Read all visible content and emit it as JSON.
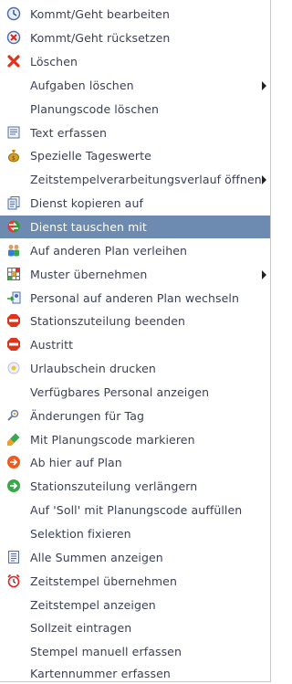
{
  "menu": {
    "items": [
      {
        "label": "Kommt/Geht bearbeiten",
        "icon": "clock-edit-icon"
      },
      {
        "label": "Kommt/Geht rücksetzen",
        "icon": "clock-reset-icon"
      },
      {
        "label": "Löschen",
        "icon": "delete-x-icon"
      },
      {
        "label": "Aufgaben löschen",
        "icon": "",
        "submenu": true
      },
      {
        "label": "Planungscode löschen",
        "icon": ""
      },
      {
        "label": "Text erfassen",
        "icon": "text-note-icon"
      },
      {
        "label": "Spezielle Tageswerte",
        "icon": "money-bag-icon"
      },
      {
        "label": "Zeitstempelverarbeitungsverlauf öffnen",
        "icon": "",
        "submenu": true
      },
      {
        "label": "Dienst kopieren auf",
        "icon": "copy-icon"
      },
      {
        "label": "Dienst tauschen mit",
        "icon": "swap-icon",
        "highlighted": true
      },
      {
        "label": "Auf anderen Plan verleihen",
        "icon": "lend-people-icon"
      },
      {
        "label": "Muster übernehmen",
        "icon": "pattern-grid-icon",
        "submenu": true
      },
      {
        "label": "Personal auf anderen Plan wechseln",
        "icon": "transfer-person-icon"
      },
      {
        "label": "Stationszuteilung beenden",
        "icon": "stop-sign-icon"
      },
      {
        "label": "Austritt",
        "icon": "stop-sign-icon"
      },
      {
        "label": "Urlaubschein drucken",
        "icon": "sun-icon"
      },
      {
        "label": "Verfügbares Personal anzeigen",
        "icon": ""
      },
      {
        "label": "Änderungen für Tag",
        "icon": "person-search-icon"
      },
      {
        "label": "Mit Planungscode markieren",
        "icon": "marker-brush-icon"
      },
      {
        "label": "Ab hier auf Plan",
        "icon": "orange-arrow-right-icon"
      },
      {
        "label": "Stationszuteilung verlängern",
        "icon": "green-arrow-right-icon"
      },
      {
        "label": "Auf 'Soll' mit Planungscode auffüllen",
        "icon": ""
      },
      {
        "label": "Selektion fixieren",
        "icon": ""
      },
      {
        "label": "Alle Summen anzeigen",
        "icon": "sum-list-icon"
      },
      {
        "label": "Zeitstempel übernehmen",
        "icon": "alarm-clock-icon"
      },
      {
        "label": "Zeitstempel anzeigen",
        "icon": ""
      },
      {
        "label": "Sollzeit eintragen",
        "icon": ""
      },
      {
        "label": "Stempel manuell erfassen",
        "icon": ""
      },
      {
        "label": "Kartennummer erfassen",
        "icon": ""
      }
    ]
  },
  "colors": {
    "highlight": "#6d8ab0",
    "text": "#3a3f56"
  }
}
